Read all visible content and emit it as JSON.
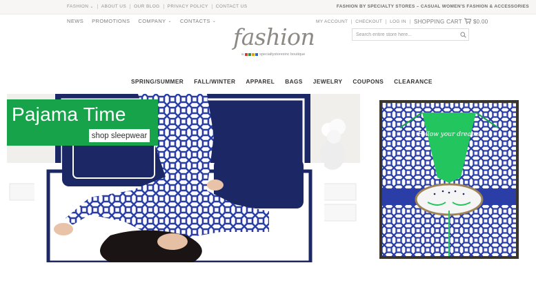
{
  "topbar": {
    "links": [
      {
        "label": "FASHION",
        "dropdown": true
      },
      {
        "label": "ABOUT US",
        "dropdown": false
      },
      {
        "label": "OUR BLOG",
        "dropdown": false
      },
      {
        "label": "PRIVACY POLICY",
        "dropdown": false
      },
      {
        "label": "CONTACT US",
        "dropdown": false
      }
    ],
    "tagline": "FASHION BY SPECIALTY STORES – CASUAL WOMEN'S FASHION & ACCESSORIES"
  },
  "subnav": {
    "items": [
      {
        "label": "NEWS",
        "dropdown": false
      },
      {
        "label": "PROMOTIONS",
        "dropdown": false
      },
      {
        "label": "COMPANY",
        "dropdown": true
      },
      {
        "label": "CONTACTS",
        "dropdown": true
      }
    ]
  },
  "account": {
    "my_account": "MY ACCOUNT",
    "checkout": "CHECKOUT",
    "login": "LOG IN",
    "cart_label": "SHOPPING CART",
    "cart_total": "$0.00"
  },
  "logo": {
    "word": "fashion",
    "prefix": "a",
    "brand": "specialtystoresinc",
    "suffix": "boutique",
    "square_colors": [
      "#d33b3b",
      "#3a8f3a",
      "#e0a400",
      "#2f6db5"
    ]
  },
  "search": {
    "placeholder": "Search entire store here..."
  },
  "catnav": {
    "items": [
      "SPRING/SUMMER",
      "FALL/WINTER",
      "APPAREL",
      "BAGS",
      "JEWELRY",
      "COUPONS",
      "CLEARANCE"
    ]
  },
  "hero": {
    "title": "Pajama Time",
    "button": "shop sleepwear"
  },
  "product": {
    "eye_mask_text": "Follow your dreams"
  },
  "colors": {
    "hero_green": "#16a34a",
    "pajama_blue": "#2b3ea8",
    "navy": "#1c2766",
    "accent_green": "#22c55e"
  }
}
